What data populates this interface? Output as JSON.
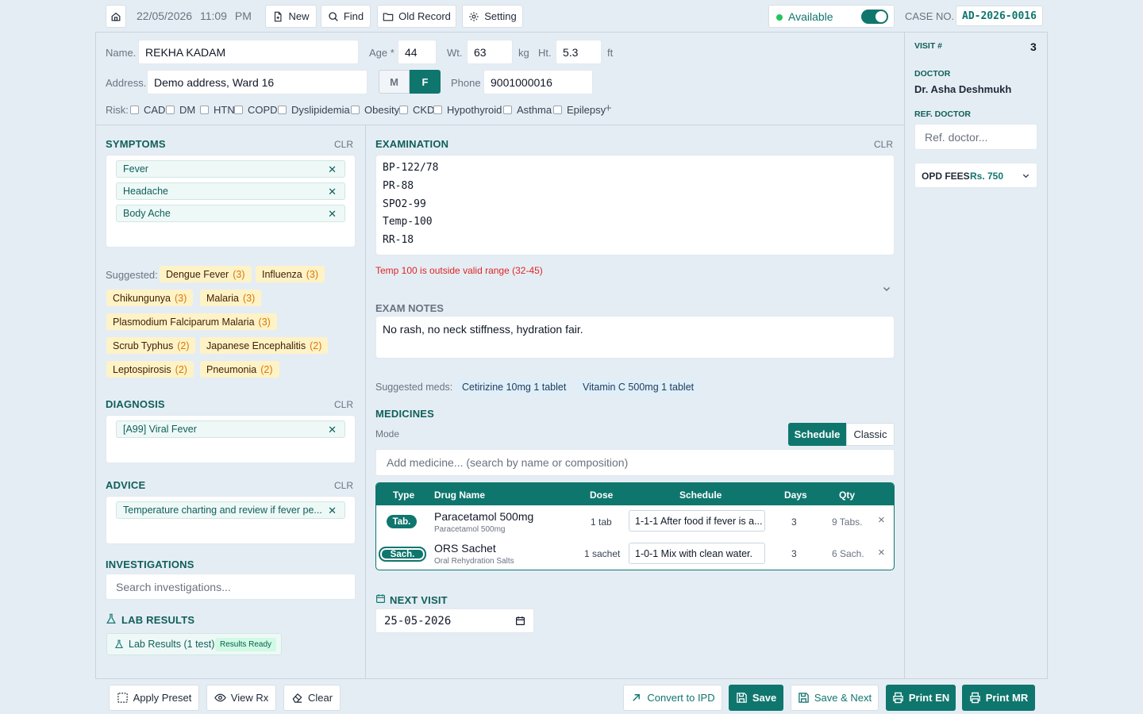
{
  "topbar": {
    "date": "22/05/2026",
    "time": "11:09 PM",
    "new_label": "New",
    "find_label": "Find",
    "old_record_label": "Old Record",
    "setting_label": "Setting",
    "available_label": "Available",
    "available_on": true,
    "case_no_label": "CASE NO.",
    "case_no": "AD-2026-0016"
  },
  "patient": {
    "name_label": "Name.",
    "name": "REKHA KADAM",
    "age_label": "Age *",
    "age": "44",
    "wt_label": "Wt.",
    "wt": "63",
    "wt_unit": "kg",
    "ht_label": "Ht.",
    "ht": "5.3",
    "ht_unit": "ft",
    "address_label": "Address.",
    "address": "Demo address, Ward 16",
    "sex_m": "M",
    "sex_f": "F",
    "sex_selected": "F",
    "phone_label": "Phone",
    "phone": "9001000016",
    "risk_label": "Risk:",
    "risks": [
      "CAD",
      "DM",
      "HTN",
      "COPD",
      "Dyslipidemia",
      "Obesity",
      "CKD",
      "Hypothyroid",
      "Asthma",
      "Epilepsy"
    ],
    "risk_add": "+"
  },
  "symptoms": {
    "title": "SYMPTOMS",
    "clr": "CLR",
    "items": [
      "Fever",
      "Headache",
      "Body Ache"
    ],
    "suggested_label": "Suggested:",
    "suggested": [
      {
        "name": "Dengue Fever",
        "count": "(3)"
      },
      {
        "name": "Influenza",
        "count": "(3)"
      },
      {
        "name": "Chikungunya",
        "count": "(3)"
      },
      {
        "name": "Malaria",
        "count": "(3)"
      },
      {
        "name": "Plasmodium Falciparum Malaria",
        "count": "(3)"
      },
      {
        "name": "Scrub Typhus",
        "count": "(2)"
      },
      {
        "name": "Japanese Encephalitis",
        "count": "(2)"
      },
      {
        "name": "Leptospirosis",
        "count": "(2)"
      },
      {
        "name": "Pneumonia",
        "count": "(2)"
      }
    ]
  },
  "diagnosis": {
    "title": "DIAGNOSIS",
    "clr": "CLR",
    "items": [
      "[A99] Viral Fever"
    ]
  },
  "advice": {
    "title": "ADVICE",
    "clr": "CLR",
    "items": [
      "Temperature charting and review if fever pe..."
    ]
  },
  "investigations": {
    "title": "INVESTIGATIONS",
    "placeholder": "Search investigations..."
  },
  "lab": {
    "title": "LAB RESULTS",
    "chip_label": "Lab Results (1 test)",
    "status": "Results Ready"
  },
  "examination": {
    "title": "EXAMINATION",
    "clr": "CLR",
    "lines": [
      "BP-122/78",
      "PR-88",
      "SPO2-99",
      "Temp-100",
      "RR-18"
    ],
    "error": "Temp 100 is outside valid range (32-45)"
  },
  "exam_notes": {
    "title": "EXAM NOTES",
    "text": "No rash, no neck stiffness, hydration fair."
  },
  "suggested_meds": {
    "label": "Suggested meds:",
    "items": [
      "Cetirizine 10mg 1 tablet",
      "Vitamin C 500mg 1 tablet"
    ]
  },
  "medicines": {
    "title": "MEDICINES",
    "mode_label": "Mode",
    "mode_schedule": "Schedule",
    "mode_classic": "Classic",
    "mode_selected": "Schedule",
    "add_placeholder": "Add medicine... (search by name or composition)",
    "columns": [
      "Type",
      "Drug Name",
      "Dose",
      "Schedule",
      "Days",
      "Qty"
    ],
    "rows": [
      {
        "type": "Tab.",
        "name": "Paracetamol 500mg",
        "composition": "Paracetamol 500mg",
        "dose": "1 tab",
        "schedule": "1-1-1 After food if fever is a...",
        "days": "3",
        "qty": "9 Tabs."
      },
      {
        "type": "Sach.",
        "name": "ORS Sachet",
        "composition": "Oral Rehydration Salts",
        "dose": "1 sachet",
        "schedule": "1-0-1 Mix with clean water.",
        "days": "3",
        "qty": "6 Sach."
      }
    ]
  },
  "next_visit": {
    "title": "NEXT VISIT",
    "date": "25-05-2026"
  },
  "right": {
    "visit_label": "VISIT #",
    "visit_no": "3",
    "doctor_label": "DOCTOR",
    "doctor": "Dr. Asha Deshmukh",
    "ref_label": "REF. DOCTOR",
    "ref_placeholder": "Ref. doctor...",
    "fees_label": "OPD FEES",
    "fees_value": "Rs. 750"
  },
  "bottom": {
    "apply_preset": "Apply Preset",
    "view_rx": "View Rx",
    "clear": "Clear",
    "convert_ipd": "Convert to IPD",
    "save": "Save",
    "save_next": "Save & Next",
    "print_en": "Print EN",
    "print_mr": "Print MR"
  },
  "colors": {
    "accent": "#0f766e",
    "error": "#dc2626",
    "suggest_bg": "#fef3c7",
    "suggest_count": "#d97706"
  }
}
